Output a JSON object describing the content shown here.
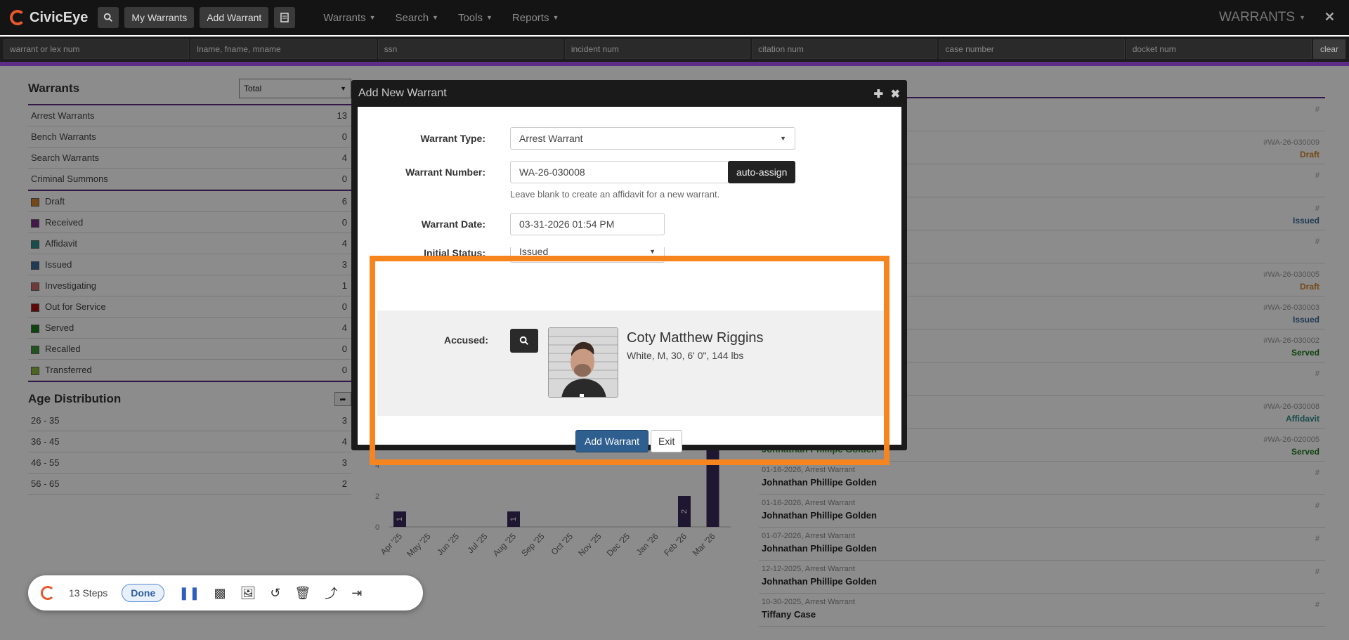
{
  "app": {
    "name": "CivicEye",
    "section_title": "WARRANTS"
  },
  "nav": {
    "my_warrants": "My Warrants",
    "add_warrant": "Add Warrant",
    "menus": [
      "Warrants",
      "Search",
      "Tools",
      "Reports"
    ]
  },
  "search_fields": {
    "f1": "warrant or lex num",
    "f2": "lname, fname, mname",
    "f3": "ssn",
    "f4": "incident num",
    "f5": "citation num",
    "f6": "case number",
    "f7": "docket num",
    "clear": "clear"
  },
  "warrants_panel": {
    "title": "Warrants",
    "filter_value": "Total",
    "types": [
      {
        "label": "Arrest Warrants",
        "count": "13"
      },
      {
        "label": "Bench Warrants",
        "count": "0"
      },
      {
        "label": "Search Warrants",
        "count": "4"
      },
      {
        "label": "Criminal Summons",
        "count": "0"
      }
    ],
    "statuses": [
      {
        "label": "Draft",
        "count": "6",
        "color": "#d4862a"
      },
      {
        "label": "Received",
        "count": "0",
        "color": "#7a2e8a"
      },
      {
        "label": "Affidavit",
        "count": "4",
        "color": "#2f8a8a"
      },
      {
        "label": "Issued",
        "count": "3",
        "color": "#3a6a9a"
      },
      {
        "label": "Investigating",
        "count": "1",
        "color": "#c86a6a"
      },
      {
        "label": "Out for Service",
        "count": "0",
        "color": "#aa1111"
      },
      {
        "label": "Served",
        "count": "4",
        "color": "#1a7a1a"
      },
      {
        "label": "Recalled",
        "count": "0",
        "color": "#3a9a3a"
      },
      {
        "label": "Transferred",
        "count": "0",
        "color": "#8ab83a"
      }
    ]
  },
  "age_panel": {
    "title": "Age Distribution",
    "rows": [
      {
        "label": "26 - 35",
        "count": "3"
      },
      {
        "label": "36 - 45",
        "count": "4"
      },
      {
        "label": "46 - 55",
        "count": "3"
      },
      {
        "label": "56 - 65",
        "count": "2"
      }
    ]
  },
  "chart_data": {
    "type": "bar",
    "categories": [
      "Apr '25",
      "May '25",
      "Jun '25",
      "Jul '25",
      "Aug '25",
      "Sep '25",
      "Oct '25",
      "Nov '25",
      "Dec '25",
      "Jan '26",
      "Feb '26",
      "Mar '26"
    ],
    "values": [
      1,
      0,
      0,
      0,
      1,
      0,
      0,
      0,
      0,
      0,
      2,
      7
    ],
    "data_labels": [
      "1",
      "",
      "",
      "",
      "1",
      "",
      "",
      "",
      "",
      "",
      "2",
      ""
    ],
    "y_ticks": [
      "0",
      "2",
      "4"
    ],
    "ylim": [
      0,
      7
    ],
    "color": "#3a2a5a"
  },
  "right_list": [
    {
      "meta": "",
      "name": "",
      "num": "#",
      "status": "",
      "status_color": ""
    },
    {
      "meta": "",
      "name": "",
      "num": "#WA-26-030009",
      "status": "Draft",
      "status_color": "#d4862a"
    },
    {
      "meta": "",
      "name": "",
      "num": "#",
      "status": "",
      "status_color": ""
    },
    {
      "meta": "",
      "name": "",
      "num": "#",
      "status": "Issued",
      "status_color": "#3a6a9a"
    },
    {
      "meta": "",
      "name": "",
      "num": "#",
      "status": "",
      "status_color": ""
    },
    {
      "meta": "",
      "name": "",
      "num": "#WA-26-030005",
      "status": "Draft",
      "status_color": "#d4862a"
    },
    {
      "meta": "",
      "name": "",
      "num": "#WA-26-030003",
      "status": "Issued",
      "status_color": "#3a6a9a"
    },
    {
      "meta": "",
      "name": "",
      "num": "#WA-26-030002",
      "status": "Served",
      "status_color": "#1a7a1a"
    },
    {
      "meta": "",
      "name": "",
      "num": "#",
      "status": "",
      "status_color": ""
    },
    {
      "meta": "",
      "name": "",
      "num": "#WA-26-030008",
      "status": "Affidavit",
      "status_color": "#2f8a8a"
    },
    {
      "meta": "",
      "name": "Johnathan Phillipe Golden",
      "num": "#WA-26-020005",
      "status": "Served",
      "status_color": "#1a7a1a"
    },
    {
      "meta": "01-16-2026, Arrest Warrant",
      "name": "Johnathan Phillipe Golden",
      "num": "#",
      "status": "",
      "status_color": ""
    },
    {
      "meta": "01-16-2026, Arrest Warrant",
      "name": "Johnathan Phillipe Golden",
      "num": "#",
      "status": "",
      "status_color": ""
    },
    {
      "meta": "01-07-2026, Arrest Warrant",
      "name": "Johnathan Phillipe Golden",
      "num": "#",
      "status": "",
      "status_color": ""
    },
    {
      "meta": "12-12-2025, Arrest Warrant",
      "name": "Johnathan Phillipe Golden",
      "num": "#",
      "status": "",
      "status_color": ""
    },
    {
      "meta": "10-30-2025, Arrest Warrant",
      "name": "Tiffany Case",
      "num": "#",
      "status": "",
      "status_color": ""
    }
  ],
  "modal": {
    "title": "Add New Warrant",
    "warrant_type_label": "Warrant Type:",
    "warrant_type_value": "Arrest Warrant",
    "warrant_number_label": "Warrant Number:",
    "warrant_number_value": "WA-26-030008",
    "auto_assign": "auto-assign",
    "hint": "Leave blank to create an affidavit for a new warrant.",
    "warrant_date_label": "Warrant Date:",
    "warrant_date_value": "03-31-2026 01:54 PM",
    "initial_status_label": "Initial Status:",
    "initial_status_value": "Issued",
    "accused_label": "Accused:",
    "accused_name": "Coty Matthew Riggins",
    "accused_desc": "White, M, 30, 6' 0\", 144 lbs",
    "add_button": "Add Warrant",
    "exit_button": "Exit"
  },
  "toolbar": {
    "steps": "13 Steps",
    "done": "Done"
  }
}
